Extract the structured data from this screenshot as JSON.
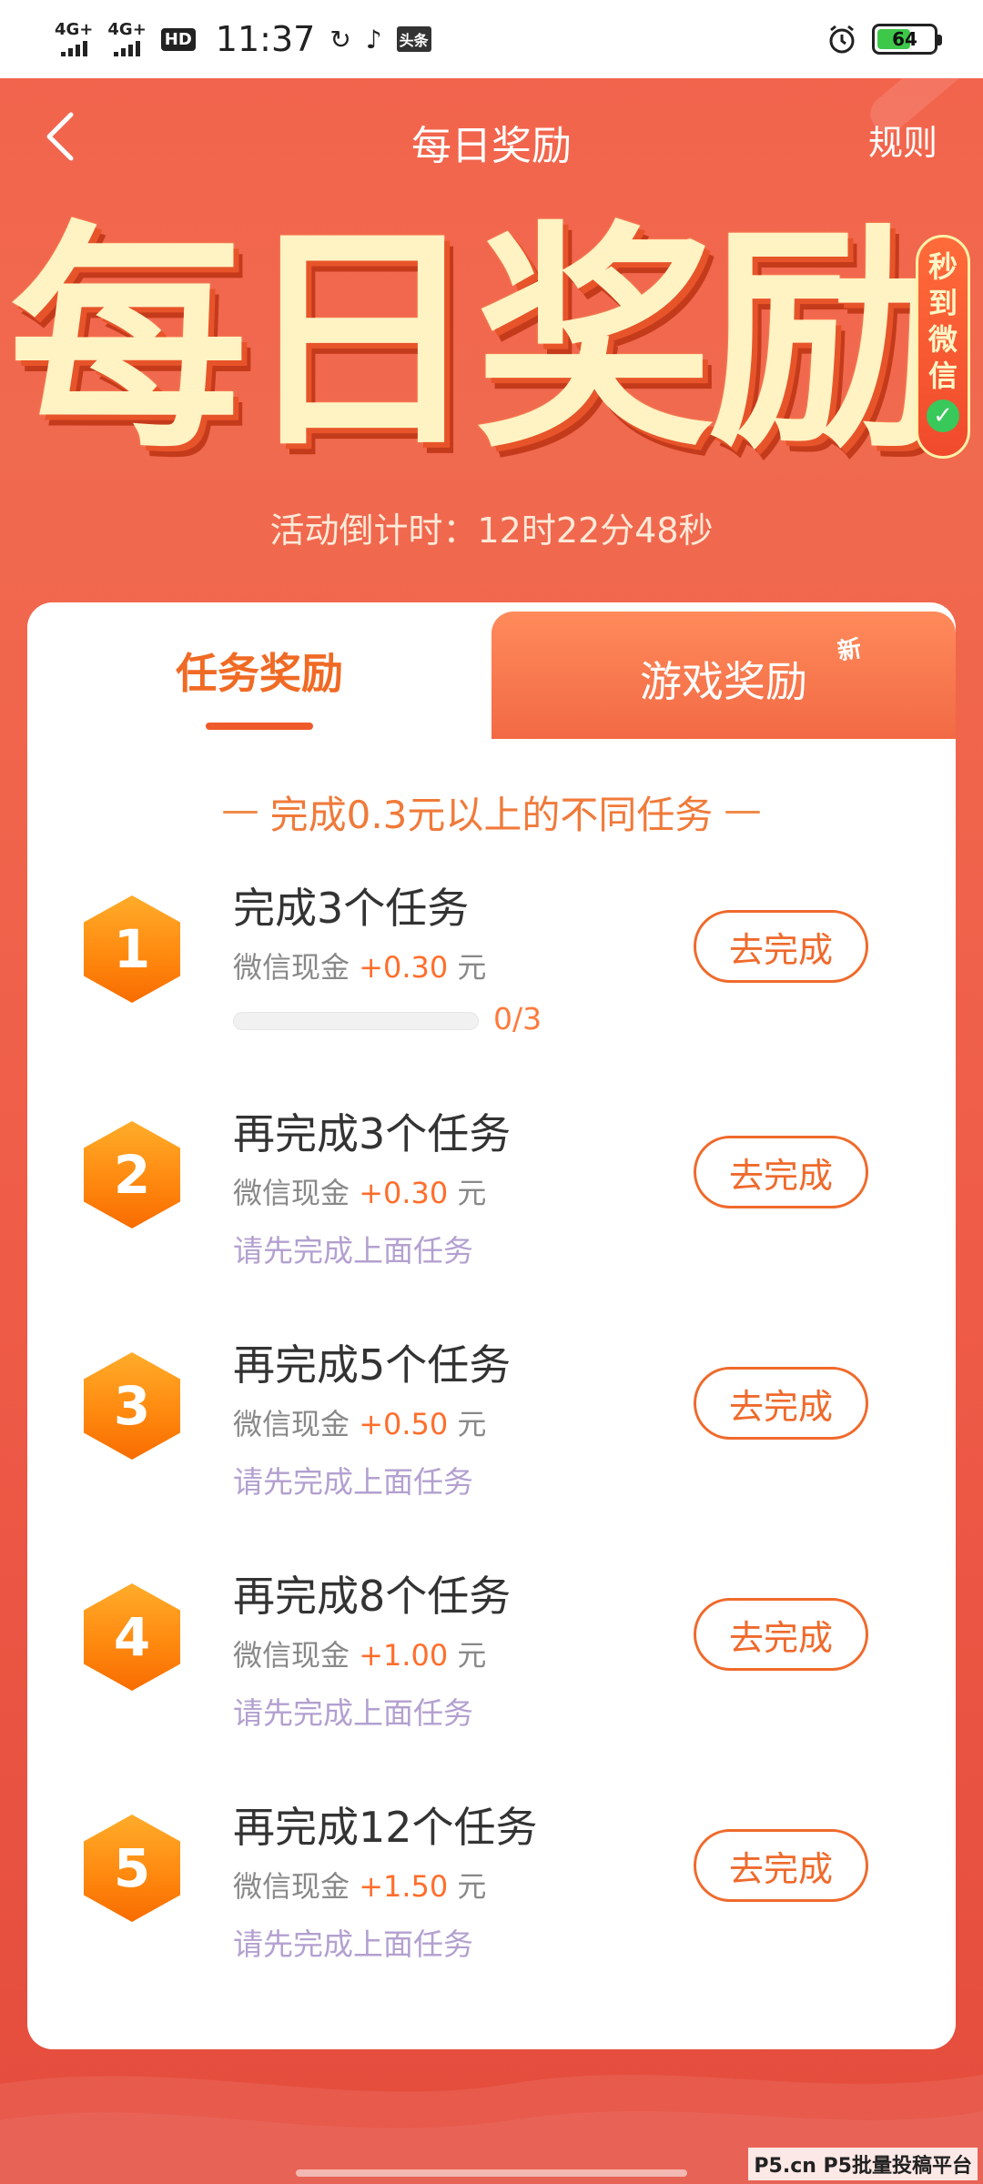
{
  "status_bar": {
    "net1": "4G+",
    "net2": "4G+",
    "hd": "HD",
    "time": "11:37",
    "toutiao": "头条",
    "battery": "64",
    "battery_level": 0.64
  },
  "header": {
    "title": "每日奖励",
    "rules": "规则"
  },
  "hero": {
    "title": "每日奖励",
    "seal_chars": [
      "秒",
      "到",
      "微",
      "信"
    ],
    "countdown": "活动倒计时：12时22分48秒"
  },
  "tabs": [
    {
      "label": "任务奖励",
      "active": true
    },
    {
      "label": "游戏奖励",
      "active": false,
      "badge": "新"
    }
  ],
  "subtitle": "完成0.3元以上的不同任务",
  "tasks": [
    {
      "num": "1",
      "title": "完成3个任务",
      "reward_label": "微信现金",
      "amount": "+0.30",
      "unit": "元",
      "progress_text": "0/3",
      "progress": 0,
      "button": "去完成"
    },
    {
      "num": "2",
      "title": "再完成3个任务",
      "reward_label": "微信现金",
      "amount": "+0.30",
      "unit": "元",
      "hint": "请先完成上面任务",
      "button": "去完成"
    },
    {
      "num": "3",
      "title": "再完成5个任务",
      "reward_label": "微信现金",
      "amount": "+0.50",
      "unit": "元",
      "hint": "请先完成上面任务",
      "button": "去完成"
    },
    {
      "num": "4",
      "title": "再完成8个任务",
      "reward_label": "微信现金",
      "amount": "+1.00",
      "unit": "元",
      "hint": "请先完成上面任务",
      "button": "去完成"
    },
    {
      "num": "5",
      "title": "再完成12个任务",
      "reward_label": "微信现金",
      "amount": "+1.50",
      "unit": "元",
      "hint": "请先完成上面任务",
      "button": "去完成"
    }
  ],
  "watermark": "P5.cn P5批量投稿平台",
  "colors": {
    "accent": "#ef6a2c",
    "background": "#f0604a",
    "hex_orange": "#ff8a10",
    "hint": "#b3a0d0"
  }
}
